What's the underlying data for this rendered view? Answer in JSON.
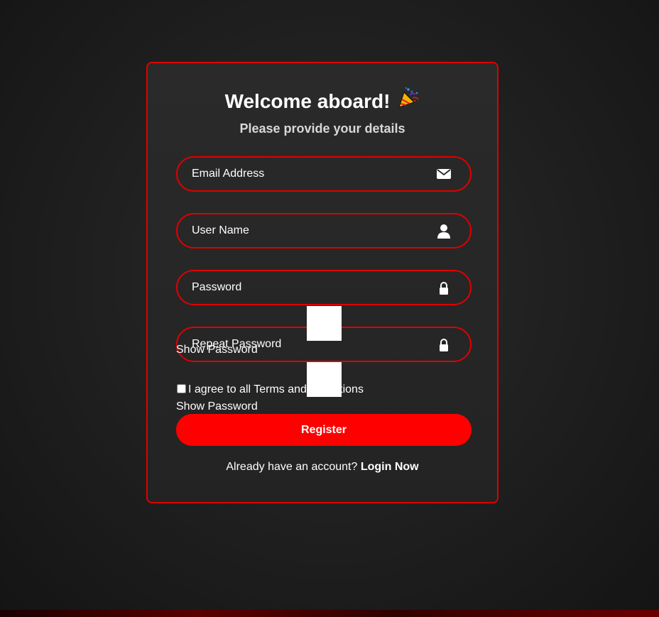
{
  "form": {
    "title": "Welcome aboard!",
    "title_emoji": "party-popper-icon",
    "subtitle": "Please provide your details",
    "fields": {
      "email": {
        "placeholder": "Email Address",
        "value": "",
        "icon": "envelope-icon"
      },
      "username": {
        "placeholder": "User Name",
        "value": "",
        "icon": "user-icon"
      },
      "password": {
        "placeholder": "Password",
        "value": "",
        "icon": "lock-icon"
      },
      "repeat_password": {
        "placeholder": "Repeat Password",
        "value": "",
        "icon": "lock-icon"
      }
    },
    "show_password_label_1": "Show Password",
    "show_password_label_2": "Show Password",
    "terms_label": "I agree to all Terms and Conditions",
    "register_label": "Register",
    "login_prompt": "Already have an account?",
    "login_link": "Login Now"
  },
  "colors": {
    "accent": "#e00000",
    "button": "#ff0000",
    "card_bg": "#262626",
    "page_bg": "#1a1a1a",
    "text": "#ffffff",
    "subtitle": "#d8d8d8"
  }
}
